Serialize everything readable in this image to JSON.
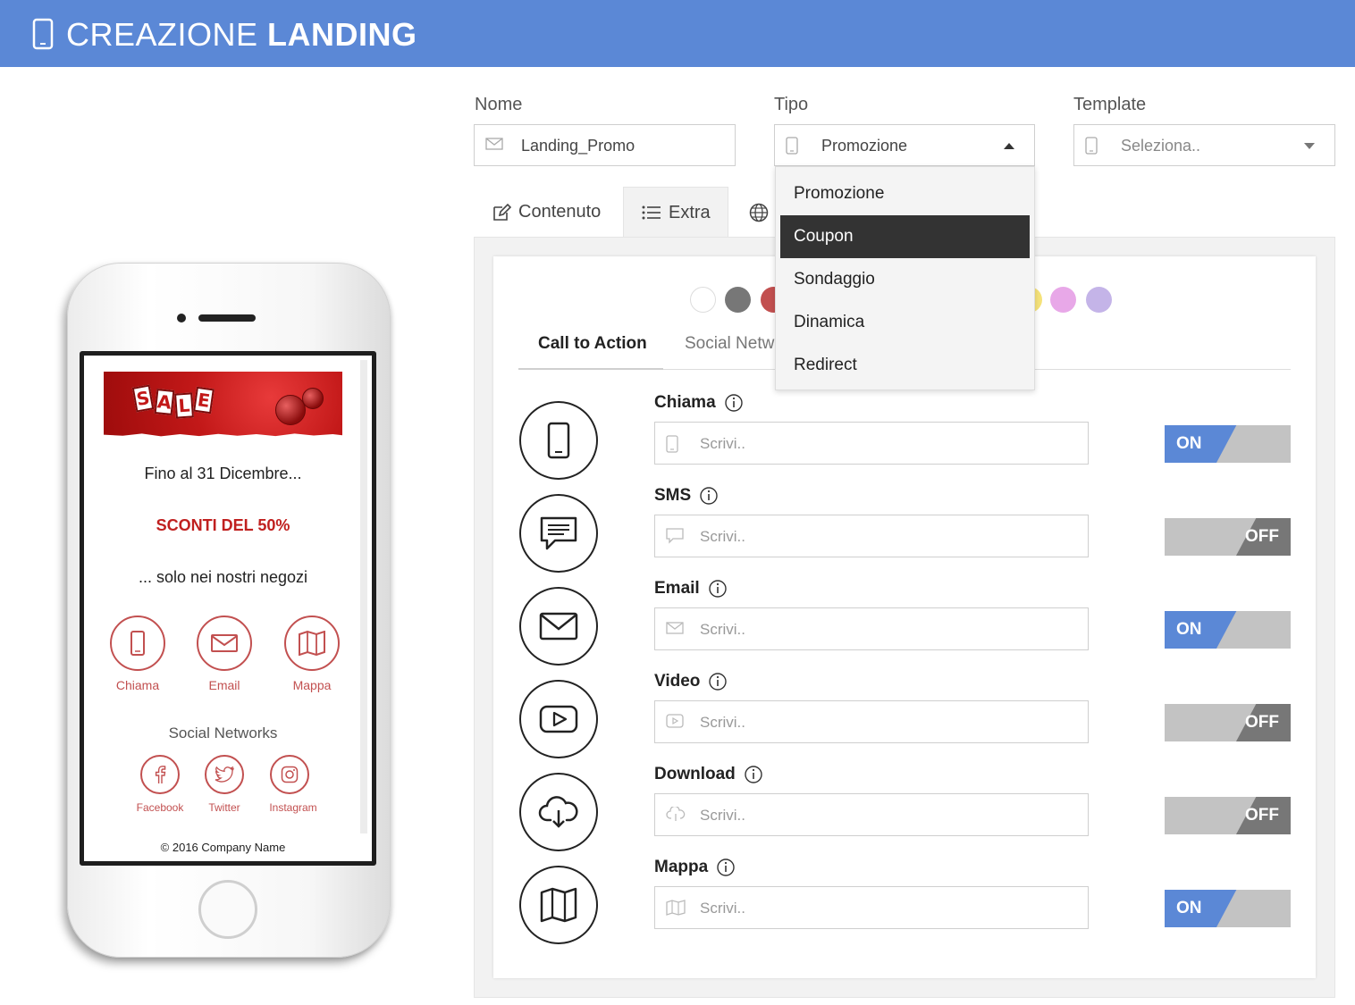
{
  "header": {
    "title_light": "CREAZIONE",
    "title_bold": "LANDING"
  },
  "form": {
    "nome": {
      "label": "Nome",
      "value": "Landing_Promo"
    },
    "tipo": {
      "label": "Tipo",
      "value": "Promozione"
    },
    "template": {
      "label": "Template",
      "placeholder": "Seleziona.."
    }
  },
  "tabs": [
    {
      "label": "Contenuto"
    },
    {
      "label": "Extra"
    }
  ],
  "dropdown": {
    "options": [
      "Promozione",
      "Coupon",
      "Sondaggio",
      "Dinamica",
      "Redirect"
    ],
    "highlighted": "Coupon"
  },
  "swatches": [
    "#ffffff",
    "#777777",
    "#c25050",
    "#f5e27a",
    "#e8a8e8",
    "#c4b4e8"
  ],
  "subtabs": [
    "Call to Action",
    "Social Netw"
  ],
  "cta": [
    {
      "label": "Chiama",
      "placeholder": "Scrivi..",
      "toggle": "ON"
    },
    {
      "label": "SMS",
      "placeholder": "Scrivi..",
      "toggle": "OFF"
    },
    {
      "label": "Email",
      "placeholder": "Scrivi..",
      "toggle": "ON"
    },
    {
      "label": "Video",
      "placeholder": "Scrivi..",
      "toggle": "OFF"
    },
    {
      "label": "Download",
      "placeholder": "Scrivi..",
      "toggle": "OFF"
    },
    {
      "label": "Mappa",
      "placeholder": "Scrivi..",
      "toggle": "ON"
    }
  ],
  "phone": {
    "line1": "Fino al 31 Dicembre...",
    "line2": "SCONTI DEL 50%",
    "line3": "... solo nei nostri negozi",
    "actions": [
      "Chiama",
      "Email",
      "Mappa"
    ],
    "social_title": "Social Networks",
    "social": [
      "Facebook",
      "Twitter",
      "Instagram"
    ],
    "footer": "© 2016 Company Name",
    "banner_letters": [
      "S",
      "A",
      "L",
      "E"
    ]
  },
  "colors": {
    "header": "#5b88d6",
    "accent_red": "#c25050",
    "toggle_on": "#5b88d6",
    "toggle_off": "#c3c3c3"
  }
}
